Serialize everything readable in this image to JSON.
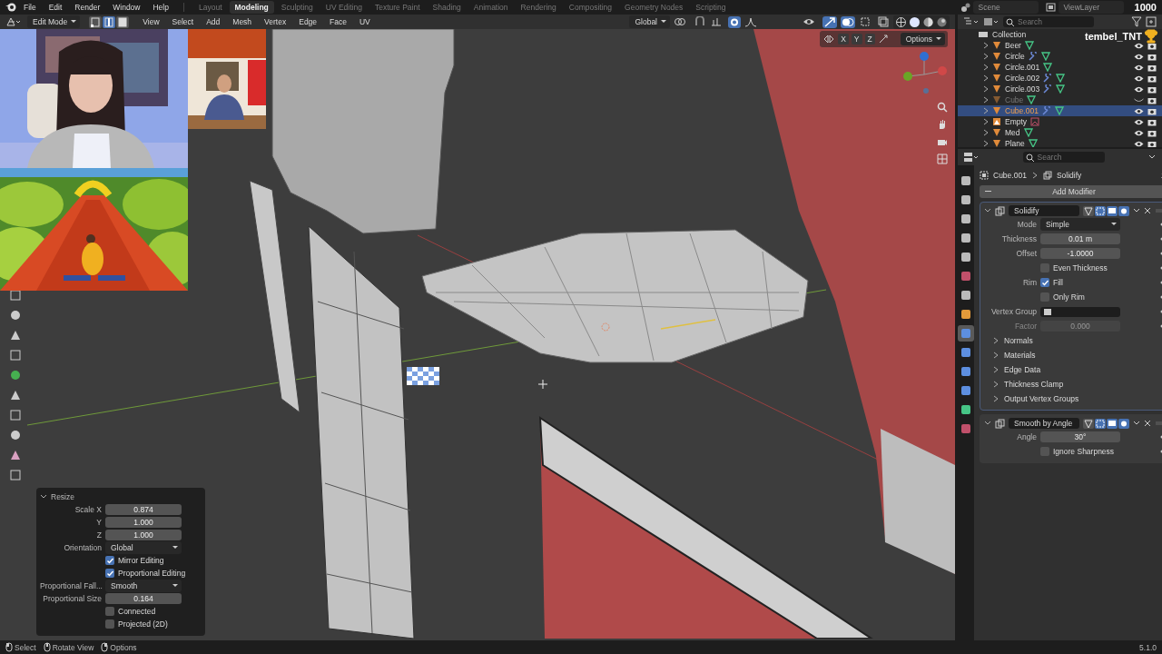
{
  "menu_bar": {
    "menus": [
      "File",
      "Edit",
      "Render",
      "Window",
      "Help"
    ],
    "workspaces": [
      {
        "label": "Layout",
        "selected": false
      },
      {
        "label": "Modeling",
        "selected": true
      },
      {
        "label": "Sculpting",
        "selected": false
      },
      {
        "label": "UV Editing",
        "selected": false
      },
      {
        "label": "Texture Paint",
        "selected": false
      },
      {
        "label": "Shading",
        "selected": false
      },
      {
        "label": "Animation",
        "selected": false
      },
      {
        "label": "Rendering",
        "selected": false
      },
      {
        "label": "Compositing",
        "selected": false
      },
      {
        "label": "Geometry Nodes",
        "selected": false
      },
      {
        "label": "Scripting",
        "selected": false
      }
    ],
    "scene": "Scene",
    "view_layer": "ViewLayer",
    "counter": "1000"
  },
  "viewport_header": {
    "mode": "Edit Mode",
    "select_modes": [
      {
        "selected": false
      },
      {
        "selected": true
      },
      {
        "selected": false
      }
    ],
    "menus": [
      "View",
      "Select",
      "Add",
      "Mesh",
      "Vertex",
      "Edge",
      "Face",
      "UV"
    ],
    "orientation": "Global",
    "axes": [
      "X",
      "Y",
      "Z"
    ],
    "options": "Options"
  },
  "stream_overlay": {
    "username": "tembel_TNT"
  },
  "outliner": {
    "search_placeholder": "Search",
    "collection": "Collection",
    "items": [
      {
        "name": "Beer",
        "kind": "mesh",
        "has_modifier": false,
        "hidden": false,
        "selected": false
      },
      {
        "name": "Circle",
        "kind": "mesh",
        "has_modifier": true,
        "hidden": false,
        "selected": false
      },
      {
        "name": "Circle.001",
        "kind": "mesh",
        "has_modifier": false,
        "hidden": false,
        "selected": false
      },
      {
        "name": "Circle.002",
        "kind": "mesh",
        "has_modifier": true,
        "hidden": false,
        "selected": false
      },
      {
        "name": "Circle.003",
        "kind": "mesh",
        "has_modifier": true,
        "hidden": false,
        "selected": false
      },
      {
        "name": "Cube",
        "kind": "mesh",
        "has_modifier": false,
        "hidden": true,
        "selected": false
      },
      {
        "name": "Cube.001",
        "kind": "mesh",
        "has_modifier": true,
        "hidden": false,
        "selected": true
      },
      {
        "name": "Empty",
        "kind": "empty",
        "has_modifier": false,
        "hidden": false,
        "selected": false
      },
      {
        "name": "Med",
        "kind": "mesh",
        "has_modifier": false,
        "hidden": false,
        "selected": false
      },
      {
        "name": "Plane",
        "kind": "mesh",
        "has_modifier": false,
        "hidden": false,
        "selected": false
      }
    ]
  },
  "properties": {
    "search_placeholder": "Search",
    "object": "Cube.001",
    "modifier": "Solidify",
    "add_modifier": "Add Modifier",
    "tabs": [
      {
        "kind": "tool",
        "selected": false
      },
      {
        "kind": "render",
        "selected": false
      },
      {
        "kind": "output",
        "selected": false
      },
      {
        "kind": "view_layer",
        "selected": false
      },
      {
        "kind": "scene",
        "selected": false
      },
      {
        "kind": "world",
        "selected": false
      },
      {
        "kind": "collection",
        "selected": false
      },
      {
        "kind": "object",
        "selected": false
      },
      {
        "kind": "modifier",
        "selected": true
      },
      {
        "kind": "particles",
        "selected": false
      },
      {
        "kind": "physics",
        "selected": false
      },
      {
        "kind": "constraints",
        "selected": false
      },
      {
        "kind": "data",
        "selected": false
      },
      {
        "kind": "material",
        "selected": false
      }
    ],
    "modifiers": [
      {
        "name": "Solidify",
        "expanded": true,
        "toggles": [
          {
            "on": false
          },
          {
            "on": true
          },
          {
            "on": true
          },
          {
            "on": true
          }
        ],
        "fields": [
          {
            "kind": "dropdown",
            "label": "Mode",
            "value": "Simple",
            "disabled": false
          },
          {
            "kind": "number",
            "label": "Thickness",
            "value": "0.01 m",
            "disabled": false
          },
          {
            "kind": "number",
            "label": "Offset",
            "value": "-1.0000",
            "disabled": false
          },
          {
            "kind": "checkbox",
            "text": "Even Thickness",
            "checked": false,
            "disabled": false
          },
          {
            "kind": "checkbox",
            "label": "Rim",
            "text": "Fill",
            "checked": true,
            "disabled": false
          },
          {
            "kind": "checkbox",
            "text": "Only Rim",
            "checked": false,
            "disabled": false
          },
          {
            "kind": "group",
            "label": "Vertex Group",
            "disabled": false
          },
          {
            "kind": "number",
            "label": "Factor",
            "value": "0.000",
            "disabled": true
          }
        ],
        "subpanels": [
          {
            "label": "Normals",
            "expanded": false
          },
          {
            "label": "Materials",
            "expanded": false
          },
          {
            "label": "Edge Data",
            "expanded": false
          },
          {
            "label": "Thickness Clamp",
            "expanded": false
          },
          {
            "label": "Output Vertex Groups",
            "expanded": false
          }
        ]
      },
      {
        "name": "Smooth by Angle",
        "expanded": true,
        "toggles": [
          {
            "on": false
          },
          {
            "on": true
          },
          {
            "on": true
          },
          {
            "on": true
          }
        ],
        "fields": [
          {
            "kind": "number",
            "label": "Angle",
            "value": "30°",
            "disabled": false
          },
          {
            "kind": "checkbox",
            "text": "Ignore Sharpness",
            "checked": false,
            "disabled": false
          }
        ]
      }
    ]
  },
  "operator_panel": {
    "title": "Resize",
    "expanded": true,
    "fields": [
      {
        "kind": "number",
        "label": "Scale X",
        "value": "0.874",
        "disabled": false
      },
      {
        "kind": "number",
        "label": "Y",
        "value": "1.000",
        "disabled": false
      },
      {
        "kind": "number",
        "label": "Z",
        "value": "1.000",
        "disabled": false
      },
      {
        "kind": "dropdown",
        "label": "Orientation",
        "value": "Global",
        "disabled": false
      },
      {
        "kind": "checkbox",
        "text": "Mirror Editing",
        "checked": true,
        "disabled": false
      },
      {
        "kind": "checkbox",
        "text": "Proportional Editing",
        "checked": true,
        "disabled": false
      },
      {
        "kind": "dropdown",
        "label": "Proportional Fall...",
        "value": "Smooth",
        "disabled": false
      },
      {
        "kind": "number",
        "label": "Proportional Size",
        "value": "0.164",
        "disabled": false
      },
      {
        "kind": "checkbox",
        "text": "Connected",
        "checked": false,
        "disabled": false
      },
      {
        "kind": "checkbox",
        "text": "Projected (2D)",
        "checked": false,
        "disabled": false
      }
    ]
  },
  "status_bar": {
    "hints": [
      "Select",
      "Rotate View",
      "Options"
    ],
    "version": "5.1.0"
  }
}
